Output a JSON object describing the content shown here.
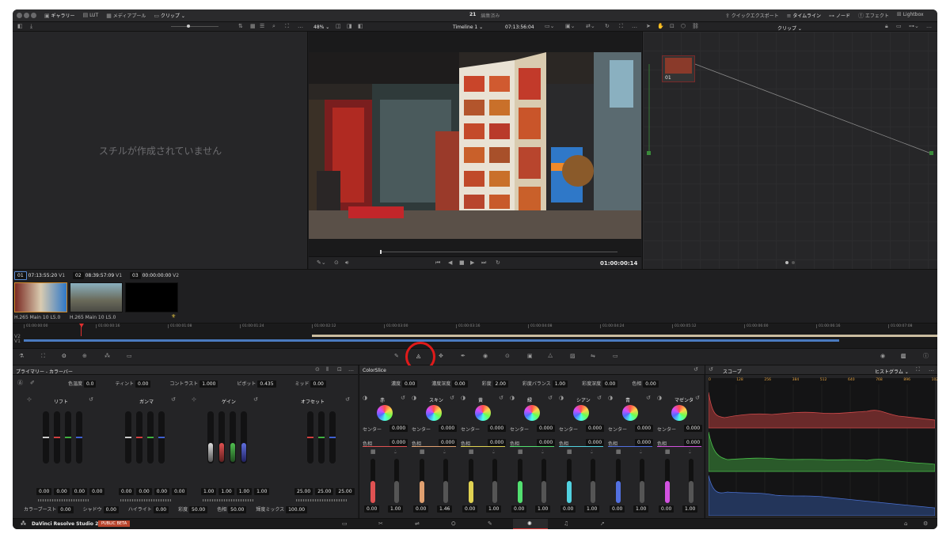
{
  "top_bar": {
    "gallery": "ギャラリー",
    "lut": "LUT",
    "media_pool": "メディアプール",
    "clips": "クリップ",
    "project_number": "21",
    "project_status": "編集済み",
    "quick_export": "クイックエクスポート",
    "timeline": "タイムライン",
    "nodes": "ノード",
    "effects": "エフェクト",
    "lightbox": "Lightbox"
  },
  "tool_bar": {
    "zoom": "48%",
    "timeline_name": "Timeline 1",
    "timecode": "07:13:56:04",
    "clip_menu": "クリップ"
  },
  "gallery": {
    "empty_text": "スチルが作成されていません"
  },
  "viewer": {
    "timecode": "01:00:00:14"
  },
  "node": {
    "label": "01"
  },
  "clips": {
    "items": [
      {
        "index": "01",
        "timecode": "07:13:55:20",
        "track": "V1"
      },
      {
        "index": "02",
        "timecode": "08:39:57:09",
        "track": "V1"
      },
      {
        "index": "03",
        "timecode": "00:00:00:00",
        "track": "V2"
      }
    ],
    "codec": "H.265 Main 10 L5.0",
    "codec2": "H.265 Main 10 L5.0"
  },
  "ruler": {
    "ticks": [
      "01:00:00:00",
      "01:00:00:16",
      "01:00:01:08",
      "01:00:01:24",
      "01:00:02:12",
      "01:00:03:00",
      "01:00:03:16",
      "01:00:04:08",
      "01:00:04:24",
      "01:00:05:12",
      "01:00:06:00",
      "01:00:06:16",
      "01:00:07:08"
    ],
    "v2": "V2",
    "v1": "V1"
  },
  "primaries": {
    "title": "プライマリー - カラーバー",
    "params": [
      {
        "label": "色温度",
        "value": "0.0"
      },
      {
        "label": "ティント",
        "value": "0.00"
      },
      {
        "label": "コントラスト",
        "value": "1.000"
      },
      {
        "label": "ピボット",
        "value": "0.435"
      },
      {
        "label": "ミッド",
        "value": "0.00"
      }
    ],
    "wheels": [
      {
        "name": "リフト",
        "values": [
          "0.00",
          "0.00",
          "0.00",
          "0.00"
        ]
      },
      {
        "name": "ガンマ",
        "values": [
          "0.00",
          "0.00",
          "0.00",
          "0.00"
        ]
      },
      {
        "name": "ゲイン",
        "values": [
          "1.00",
          "1.00",
          "1.00",
          "1.00"
        ]
      },
      {
        "name": "オフセット",
        "values": [
          "25.00",
          "25.00",
          "25.00"
        ]
      }
    ],
    "bottom": [
      {
        "label": "カラーブースト",
        "value": "0.00"
      },
      {
        "label": "シャドウ",
        "value": "0.00"
      },
      {
        "label": "ハイライト",
        "value": "0.00"
      },
      {
        "label": "彩度",
        "value": "50.00"
      },
      {
        "label": "色相",
        "value": "50.00"
      },
      {
        "label": "輝度ミックス",
        "value": "100.00"
      }
    ]
  },
  "colorslice": {
    "title": "ColorSlice",
    "params": [
      {
        "label": "濃度",
        "value": "0.00"
      },
      {
        "label": "濃度深度",
        "value": "0.00"
      },
      {
        "label": "彩度",
        "value": "2.00"
      },
      {
        "label": "彩度バランス",
        "value": "1.00"
      },
      {
        "label": "彩度深度",
        "value": "0.00"
      },
      {
        "label": "色相",
        "value": "0.00"
      }
    ],
    "center_label": "センター",
    "hue_label": "色相",
    "columns": [
      {
        "name": "赤",
        "center": "0.000",
        "hue": "0.000",
        "low": "0.00",
        "high": "1.00",
        "color": "#e05252"
      },
      {
        "name": "スキン",
        "center": "0.000",
        "hue": "0.000",
        "low": "0.00",
        "high": "1.46",
        "color": "#e0a070"
      },
      {
        "name": "黄",
        "center": "0.000",
        "hue": "0.000",
        "low": "0.00",
        "high": "1.00",
        "color": "#e0d252"
      },
      {
        "name": "緑",
        "center": "0.000",
        "hue": "0.000",
        "low": "0.00",
        "high": "1.00",
        "color": "#52e070"
      },
      {
        "name": "シアン",
        "center": "0.000",
        "hue": "0.000",
        "low": "0.00",
        "high": "1.00",
        "color": "#52d2e0"
      },
      {
        "name": "青",
        "center": "0.000",
        "hue": "0.000",
        "low": "0.00",
        "high": "1.00",
        "color": "#5270e0"
      },
      {
        "name": "マゼンタ",
        "center": "0.000",
        "hue": "0.000",
        "low": "0.00",
        "high": "1.00",
        "color": "#d252e0"
      }
    ]
  },
  "scope": {
    "title": "スコープ",
    "mode": "ヒストグラム",
    "ticks": [
      "0",
      "128",
      "256",
      "384",
      "512",
      "640",
      "768",
      "896",
      "1023"
    ]
  },
  "bottom_bar": {
    "app_name": "DaVinci Resolve Studio 21",
    "badge": "PUBLIC BETA"
  },
  "colors": {
    "accent": "#e0a040",
    "highlight_ring": "#e01a1a",
    "badge_bg": "#b8452d"
  }
}
